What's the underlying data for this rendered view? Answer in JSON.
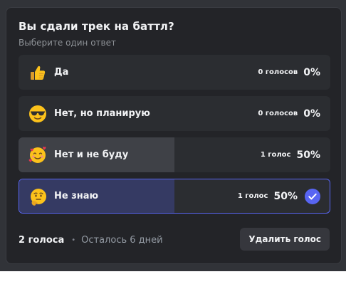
{
  "poll": {
    "question": "Вы сдали трек на баттл?",
    "subtitle": "Выберите один ответ",
    "answers": [
      {
        "emoji": "thumbs-up-icon",
        "label": "Да",
        "votes": "0 голосов",
        "percent": "0%",
        "share": 0,
        "selected": false
      },
      {
        "emoji": "sunglasses-face-icon",
        "label": "Нет, но планирую",
        "votes": "0 голосов",
        "percent": "0%",
        "share": 0,
        "selected": false
      },
      {
        "emoji": "smiling-face-with-hearts-icon",
        "label": "Нет и не буду",
        "votes": "1 голос",
        "percent": "50%",
        "share": 0.5,
        "selected": false
      },
      {
        "emoji": "thinking-face-icon",
        "label": "Не знаю",
        "votes": "1 голос",
        "percent": "50%",
        "share": 0.5,
        "selected": true
      }
    ],
    "footer": {
      "total_votes": "2 голоса",
      "separator": "•",
      "time_left": "Осталось 6 дней",
      "remove_vote_label": "Удалить голос"
    }
  },
  "colors": {
    "accent": "#5865f2",
    "card_bg": "#232428",
    "answer_bg": "#2b2d31",
    "fill": "#3f4147",
    "selected_fill": "#353a63"
  }
}
